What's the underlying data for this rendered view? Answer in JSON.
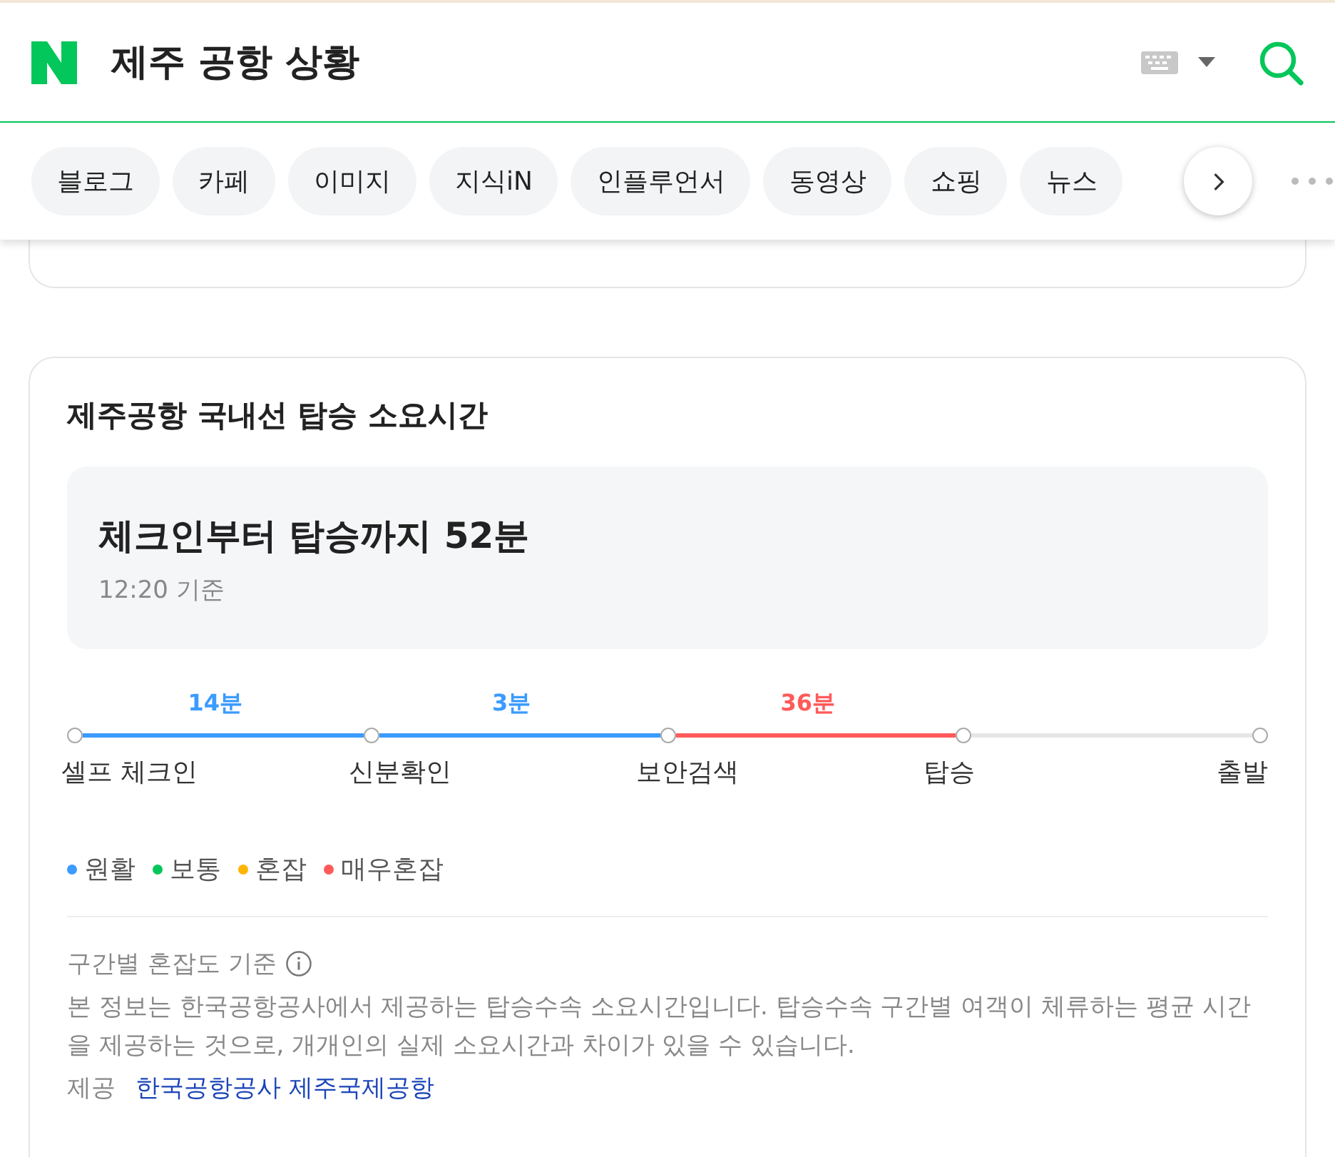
{
  "search": {
    "query": "제주 공항 상황"
  },
  "tabs": [
    {
      "label": "블로그",
      "selected": false
    },
    {
      "label": "카페",
      "selected": false
    },
    {
      "label": "이미지",
      "selected": false
    },
    {
      "label": "지식iN",
      "selected": false
    },
    {
      "label": "인플루언서",
      "selected": false
    },
    {
      "label": "동영상",
      "selected": false
    },
    {
      "label": "쇼핑",
      "selected": false
    },
    {
      "label": "뉴스",
      "selected": false
    }
  ],
  "card": {
    "title": "제주공항 국내선 탑승 소요시간",
    "summary": {
      "headline": "체크인부터 탑승까지 52분",
      "time": "12:20 기준"
    },
    "stops": [
      "셀프 체크인",
      "신분확인",
      "보안검색",
      "탑승",
      "출발"
    ],
    "segments": [
      {
        "duration": "14분",
        "color": "#3b9bff"
      },
      {
        "duration": "3분",
        "color": "#3b9bff"
      },
      {
        "duration": "36분",
        "color": "#ff5a5a"
      },
      {
        "color": "#e6e6e6"
      }
    ],
    "legend": [
      {
        "label": "원활",
        "color": "#3b9bff"
      },
      {
        "label": "보통",
        "color": "#03c75a"
      },
      {
        "label": "혼잡",
        "color": "#ffb400"
      },
      {
        "label": "매우혼잡",
        "color": "#ff5a5a"
      }
    ],
    "info_title": "구간별 혼잡도 기준",
    "info_text": "본 정보는 한국공항공사에서 제공하는 탑승수속 소요시간입니다. 탑승수속 구간별 여객이 체류하는 평균 시간을 제공하는 것으로, 개개인의 실제 소요시간과 차이가 있을 수 있습니다.",
    "source_label": "제공",
    "source_link": "한국공항공사 제주국제공항"
  }
}
